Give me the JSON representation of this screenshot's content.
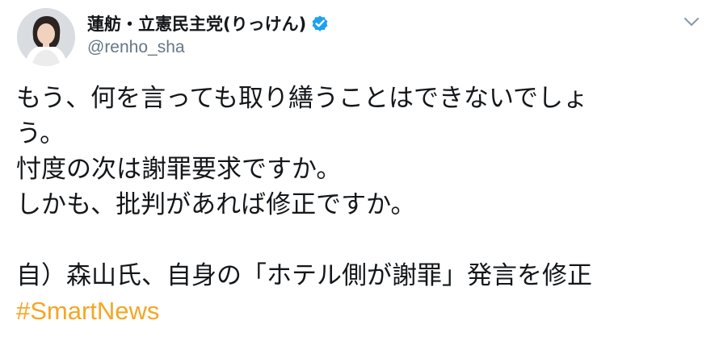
{
  "user": {
    "display_name": "蓮舫・立憲民主党(りっけん)",
    "handle": "@renho_sha",
    "verified": true
  },
  "tweet": {
    "lines": [
      "もう、何を言っても取り繕うことはできないでしょ",
      "う。",
      "忖度の次は謝罪要求ですか。",
      "しかも、批判があれば修正ですか。",
      "",
      "自）森山氏、自身の「ホテル側が謝罪」発言を修正"
    ],
    "hashtag": "#SmartNews"
  },
  "colors": {
    "verified": "#1da1f2",
    "hashtag": "#f5a623",
    "handle": "#657786",
    "text": "#14171a"
  },
  "icons": {
    "verified": "verified-badge-icon",
    "menu": "chevron-down-icon"
  }
}
